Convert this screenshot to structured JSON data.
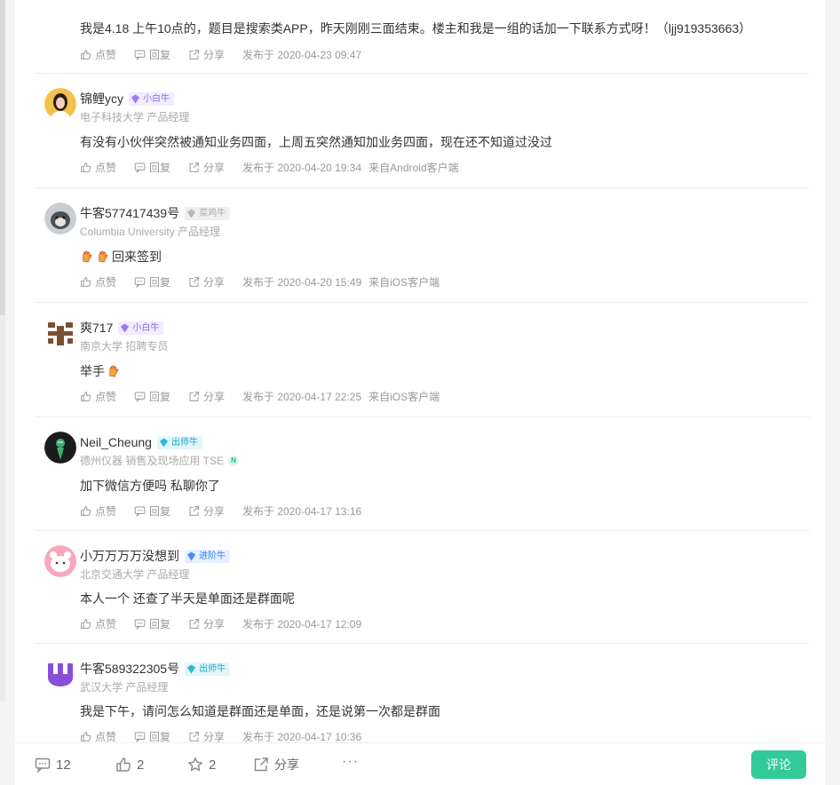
{
  "colors": {
    "accent": "#32ca99",
    "muted": "#999999",
    "badge_purple": "#8a6bf0",
    "badge_teal": "#19a4c7",
    "badge_blue": "#3b7ef2"
  },
  "action_labels": {
    "like": "点赞",
    "reply": "回复",
    "share": "分享"
  },
  "comments": [
    {
      "content": "我是4.18 上午10点的，题目是搜索类APP，昨天刚刚三面结束。楼主和我是一组的话加一下联系方式呀！（ljj919353663）",
      "time": "发布于 2020-04-23 09:47",
      "client": ""
    },
    {
      "name": "锦鲤ycy",
      "badge": "小白牛",
      "badge_icon": "purple-diamond-icon",
      "sub": "电子科技大学 产品经理",
      "content": "有没有小伙伴突然被通知业务四面，上周五突然通知加业务四面，现在还不知道过没过",
      "time": "发布于 2020-04-20 19:34",
      "client": "来自Android客户端"
    },
    {
      "name": "牛客577417439号",
      "badge": "菜鸡牛",
      "badge_icon": "gray-diamond-icon",
      "sub": "Columbia University 产品经理",
      "content": "回来签到",
      "time": "发布于 2020-04-20 15:49",
      "client": "来自iOS客户端"
    },
    {
      "name": "爽717",
      "badge": "小白牛",
      "badge_icon": "purple-diamond-icon",
      "sub": "南京大学 招聘专员",
      "content": "举手",
      "time": "发布于 2020-04-17 22:25",
      "client": "来自iOS客户端"
    },
    {
      "name": "Neil_Cheung",
      "badge": "出师牛",
      "badge_icon": "teal-diamond-icon",
      "sub": "德州仪器  销售及现场应用  TSE",
      "content": "加下微信方便吗  私聊你了",
      "time": "发布于 2020-04-17 13:16",
      "client": ""
    },
    {
      "name": "小万万万万没想到",
      "badge": "进阶牛",
      "badge_icon": "blue-diamond-icon",
      "sub": "北京交通大学 产品经理",
      "content": "本人一个 还查了半天是单面还是群面呢",
      "time": "发布于 2020-04-17 12:09",
      "client": ""
    },
    {
      "name": "牛客589322305号",
      "badge": "出师牛",
      "badge_icon": "teal-diamond-icon",
      "sub": "武汉大学 产品经理",
      "content": "我是下午，请问怎么知道是群面还是单面，还是说第一次都是群面",
      "time": "发布于 2020-04-17 10:36",
      "client": ""
    }
  ],
  "bottom_bar": {
    "comment_count": "12",
    "like_count": "2",
    "fav_count": "2",
    "share_label": "分享",
    "more_label": "···",
    "reply_button": "评论"
  }
}
